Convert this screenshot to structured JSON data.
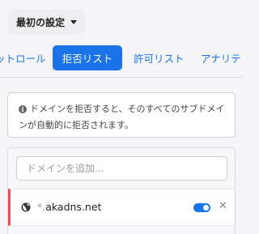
{
  "preset": {
    "label": "最初の設定"
  },
  "tabs": [
    {
      "label": "ットロール",
      "active": false
    },
    {
      "label": "拒否リスト",
      "active": true
    },
    {
      "label": "許可リスト",
      "active": false
    },
    {
      "label": "アナリテ",
      "active": false
    }
  ],
  "info": {
    "icon": "info-icon",
    "text": "ドメインを拒否すると、そのすべてのサブドメインが自動的に拒否されます。"
  },
  "denylist": {
    "add_placeholder": "ドメインを追加...",
    "entries": [
      {
        "wildcard": "*.",
        "domain": "akadns.net",
        "enabled": true,
        "icon": "globe-icon"
      }
    ]
  },
  "colors": {
    "accent": "#1a73e8",
    "entry_marker": "#e05555",
    "background": "#f5f5f7"
  }
}
